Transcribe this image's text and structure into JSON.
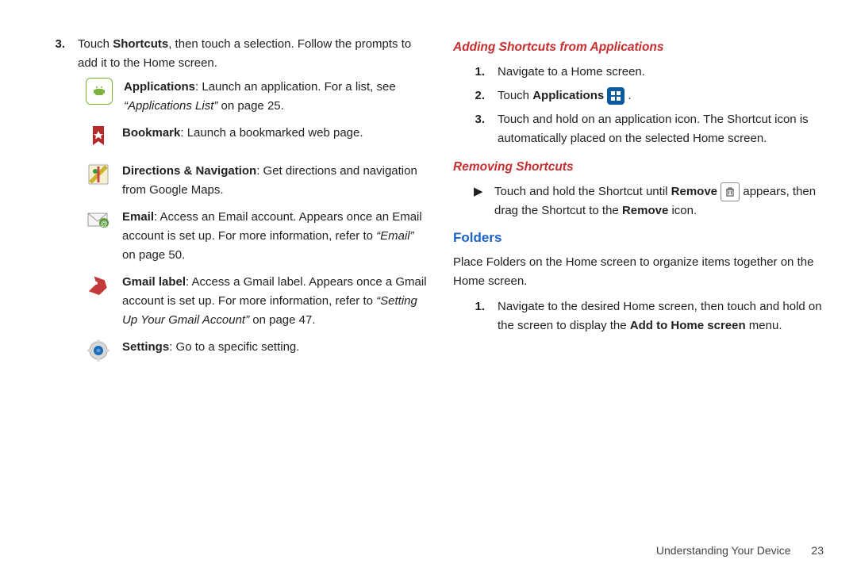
{
  "left": {
    "step3_num": "3.",
    "step3_text_a": "Touch ",
    "step3_bold": "Shortcuts",
    "step3_text_b": ", then touch a selection. Follow the prompts to add it to the Home screen.",
    "apps_bold": "Applications",
    "apps_text": ": Launch an application. For a list, see ",
    "apps_ref": "“Applications List”",
    "apps_page": " on page 25.",
    "bookmark_bold": "Bookmark",
    "bookmark_text": ": Launch a bookmarked web page.",
    "dir_bold": "Directions & Navigation",
    "dir_text": ": Get directions and navigation from Google Maps.",
    "email_bold": "Email",
    "email_text": ": Access an Email account. Appears once an Email account is set up. For more information, refer to ",
    "email_ref": "“Email” ",
    "email_page": " on page 50.",
    "gmail_bold": "Gmail label",
    "gmail_text": ": Access a Gmail label. Appears once a Gmail account is set up. For more information, refer to ",
    "gmail_ref": "“Setting Up Your Gmail Account” ",
    "gmail_page": " on page 47.",
    "settings_bold": "Settings",
    "settings_text": ": Go to a specific setting."
  },
  "right": {
    "hdr_add": "Adding Shortcuts from Applications",
    "s1_num": "1.",
    "s1_text": "Navigate to a Home screen.",
    "s2_num": "2.",
    "s2_a": "Touch ",
    "s2_bold": "Applications",
    "s2_b": " .",
    "s3_num": "3.",
    "s3_text": "Touch and hold on an application icon. The Shortcut icon is automatically placed on the selected Home screen.",
    "hdr_remove": "Removing Shortcuts",
    "rem_a": "Touch and hold the Shortcut until ",
    "rem_bold1": "Remove",
    "rem_b": " appears, then drag the Shortcut to the ",
    "rem_bold2": "Remove",
    "rem_c": " icon.",
    "hdr_folders": "Folders",
    "folders_intro": "Place Folders on the Home screen to organize items together on the Home screen.",
    "f1_num": "1.",
    "f1_a": "Navigate to the desired Home screen, then touch and hold on the screen to display the ",
    "f1_bold": "Add to Home screen",
    "f1_b": " menu."
  },
  "footer": {
    "label": "Understanding Your Device",
    "page": "23"
  },
  "glyphs": {
    "triangle": "▶"
  }
}
